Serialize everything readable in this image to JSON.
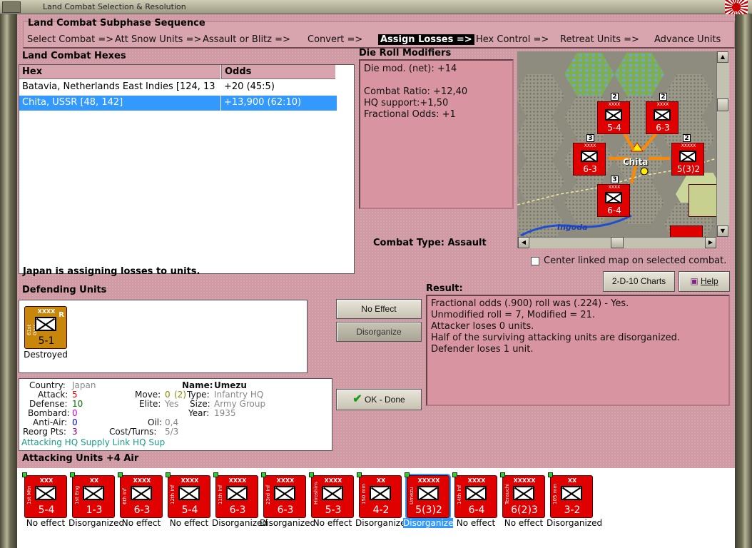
{
  "window": {
    "title": "Land Combat Selection & Resolution"
  },
  "sequence": {
    "title": "Land Combat Subphase Sequence",
    "steps": [
      "Select Combat =>",
      "Att Snow Units =>",
      "Assault or Blitz =>",
      "Convert =>",
      "Assign Losses =>",
      "Hex Control =>",
      "Retreat Units =>",
      "Advance Units"
    ],
    "active": "Assign Losses =>"
  },
  "hexes": {
    "title": "Land Combat Hexes",
    "col_hex": "Hex",
    "col_odds": "Odds",
    "rows": [
      {
        "hex": "Batavia, Netherlands East Indies [124, 13",
        "odds": "+20 (45:5)"
      },
      {
        "hex": "Chita, USSR [48, 142]",
        "odds": "+13,900 (62:10)"
      }
    ]
  },
  "modifiers": {
    "title": "Die Roll Modifiers",
    "net": "Die mod. (net): +14",
    "ratio": "Combat Ratio: +12,40",
    "hq": "HQ support:+1,50",
    "frac": "Fractional Odds: +1"
  },
  "combat_type": "Combat Type:  Assault",
  "map": {
    "city": "Chita",
    "river": "Ingoda",
    "center_label": "Center linked map on selected combat.",
    "counters": [
      {
        "value": "5-4",
        "badge": "2"
      },
      {
        "value": "6-3",
        "badge": "2"
      },
      {
        "value": "6-3",
        "badge": "3"
      },
      {
        "value": "5(3)2",
        "badge": "2"
      },
      {
        "value": "6-4",
        "badge": "3"
      }
    ]
  },
  "status": "Japan is assigning losses to units.",
  "defending": {
    "title": "Defending Units",
    "unit": {
      "size": "XXXX",
      "name": "61st Garr",
      "value": "5-1",
      "caption": "Destroyed"
    }
  },
  "buttons": {
    "no_effect": "No Effect",
    "disorganize": "Disorganize",
    "ok": "OK - Done",
    "charts": "2-D-10 Charts",
    "help": "Help"
  },
  "result": {
    "title": "Result:",
    "lines": [
      "Fractional odds (.900) roll was (.224)  - Yes.",
      "Unmodified roll = 7, Modified = 21.",
      "Attacker loses 0 units.",
      "Half of the surviving attacking units are disorganized.",
      "Defender loses 1 unit."
    ]
  },
  "info": {
    "country_l": "Country:",
    "country": "Japan",
    "attack_l": "Attack:",
    "attack": "5",
    "defense_l": "Defense:",
    "defense": "10",
    "bombard_l": "Bombard:",
    "bombard": "0",
    "aa_l": "Anti-Air:",
    "aa": "0",
    "reorg_l": "Reorg Pts:",
    "reorg": "3",
    "name_l": "Name:",
    "name": "Umezu",
    "move_l": "Move:",
    "move": "0",
    "move2": "(2)",
    "elite_l": "Elite:",
    "elite": "Yes",
    "oil_l": "Oil:",
    "oil": "0,4",
    "cost_l": "Cost/Turns:",
    "cost": "5/3",
    "type_l": "Type:",
    "type": "Infantry HQ",
    "size_l": "Size:",
    "size": "Army Group",
    "year_l": "Year:",
    "year": "1935",
    "supply": "Attacking HQ Supply Link HQ Sup"
  },
  "attacking": {
    "title": "Attacking Units +4 Air",
    "units": [
      {
        "size": "XXX",
        "name": "1st Mtn",
        "value": "5-4",
        "caption": "No effect"
      },
      {
        "size": "XX",
        "name": "1st Eng",
        "value": "1-3",
        "caption": "Disorganized"
      },
      {
        "size": "XXXX",
        "name": "6th Inf",
        "value": "6-3",
        "caption": "No effect"
      },
      {
        "size": "XXXX",
        "name": "12th Inf",
        "value": "5-4",
        "caption": "No effect"
      },
      {
        "size": "XXXX",
        "name": "11th Inf",
        "value": "6-3",
        "caption": "Disorganized"
      },
      {
        "size": "XXXX",
        "name": "23rd Inf",
        "value": "6-3",
        "caption": "Disorganized"
      },
      {
        "size": "XXXX",
        "name": "Hiroshima",
        "value": "5-3",
        "caption": "No effect"
      },
      {
        "size": "XX",
        "name": "150 mm",
        "value": "4-2",
        "caption": "Disorganized"
      },
      {
        "size": "XXXXX",
        "name": "Umezu",
        "value": "5(3)2",
        "caption": "Disorganized"
      },
      {
        "size": "XXXX",
        "name": "14th Inf",
        "value": "6-4",
        "caption": "No effect"
      },
      {
        "size": "XXXXX",
        "name": "Terauchi",
        "value": "6(2)3",
        "caption": "No effect"
      },
      {
        "size": "XX",
        "name": "105 mm",
        "value": "3-2",
        "caption": "Disorganized"
      }
    ]
  },
  "colors": {
    "panel_pink": "#cf9aa4",
    "counter_red": "#e10000",
    "counter_gold": "#c8860a",
    "select_blue": "#3399ff"
  }
}
